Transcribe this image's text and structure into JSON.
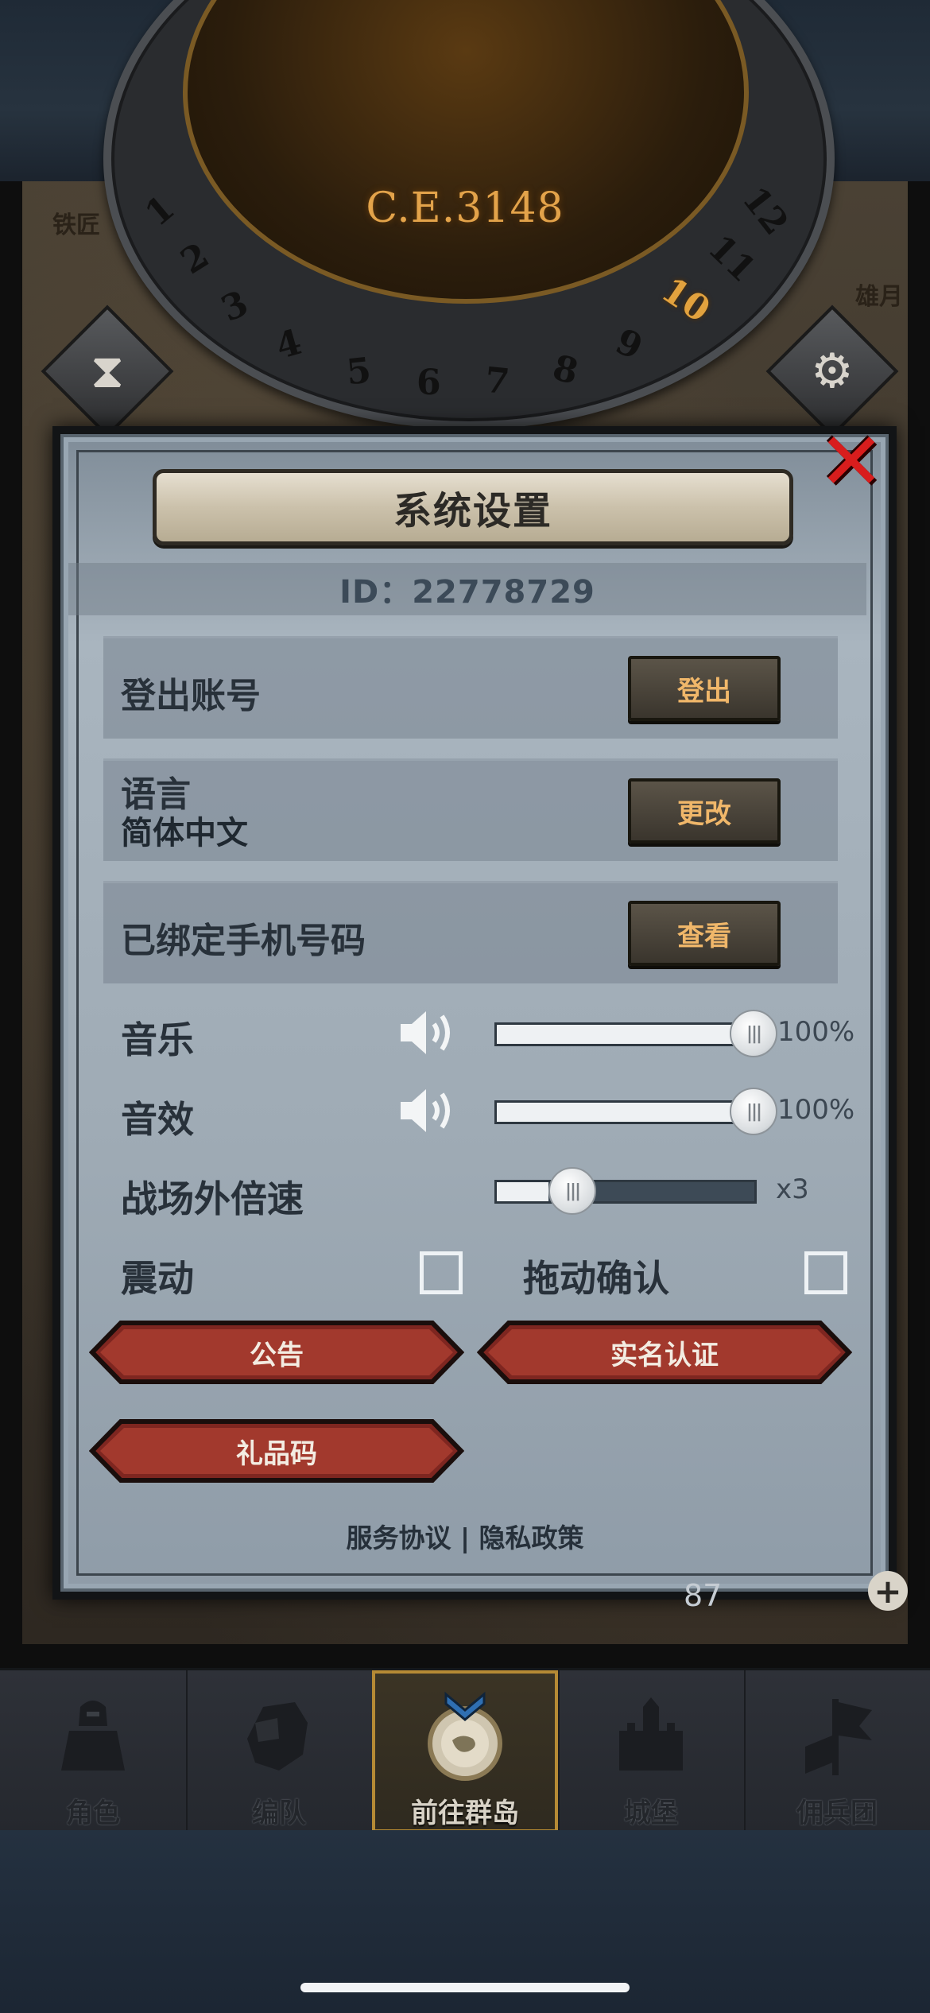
{
  "header": {
    "era": "C.E.3148",
    "dial_numbers": [
      "1",
      "2",
      "3",
      "4",
      "5",
      "6",
      "7",
      "8",
      "9",
      "10",
      "11",
      "12"
    ],
    "active_number": "10",
    "map_labels": [
      "铁匠",
      "雄月"
    ],
    "hourglass_icon": "hourglass-icon",
    "settings_icon": "gear-icon"
  },
  "settings": {
    "title": "系统设置",
    "id_text": "ID：22778729",
    "rows": [
      {
        "label": "登出账号",
        "button": "登出"
      },
      {
        "label": "语言",
        "sublabel": "简体中文",
        "button": "更改"
      },
      {
        "label": "已绑定手机号码",
        "button": "查看"
      }
    ],
    "music": {
      "label": "音乐",
      "value_text": "100%",
      "level": 1.0
    },
    "sfx": {
      "label": "音效",
      "value_text": "100%",
      "level": 1.0
    },
    "speed": {
      "label": "战场外倍速",
      "value_text": "x3",
      "level": 0.2
    },
    "vibration": {
      "label": "震动",
      "checked": false
    },
    "drag_confirm": {
      "label": "拖动确认",
      "checked": false
    },
    "buttons": {
      "notice": "公告",
      "real_name": "实名认证",
      "gift_code": "礼品码"
    },
    "footer": {
      "terms": "服务协议",
      "separator": "|",
      "privacy": "隐私政策"
    },
    "close_icon": "close-icon"
  },
  "map_overlay": {
    "resource_count": "87"
  },
  "bottom_nav": [
    {
      "label": "角色",
      "icon": "knight-icon",
      "active": false
    },
    {
      "label": "编队",
      "icon": "horse-helmet-icon",
      "active": false
    },
    {
      "label": "前往群岛",
      "icon": "island-compass-icon",
      "active": true
    },
    {
      "label": "城堡",
      "icon": "castle-icon",
      "active": false
    },
    {
      "label": "佣兵团",
      "icon": "mercenary-flag-icon",
      "active": false
    }
  ],
  "colors": {
    "panel": "#a9b5bf",
    "accent_gold": "#e3a34a",
    "button_text": "#f0b76a",
    "red_button": "#8b2a22",
    "close_red": "#d81d1d"
  }
}
